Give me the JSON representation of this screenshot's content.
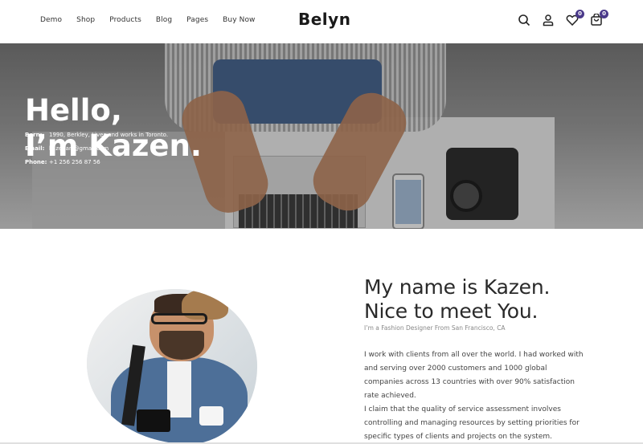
{
  "header": {
    "nav": [
      "Demo",
      "Shop",
      "Products",
      "Blog",
      "Pages",
      "Buy Now"
    ],
    "logo": "Belyn",
    "icons": [
      "search-icon",
      "user-icon",
      "heart-icon",
      "cart-icon"
    ],
    "wishlist_count": "0",
    "cart_count": "0",
    "badge_color": "#4b3a8a"
  },
  "hero": {
    "title_line1": "Hello,",
    "title_line2": "I’m Kazen.",
    "info": [
      {
        "label": "Born:",
        "value": "1990, Berkley, Lives and works in Toronto."
      },
      {
        "label": "Email:",
        "value": "kazenart@gmail.com"
      },
      {
        "label": "Phone:",
        "value": "+1 256 256 87 56"
      }
    ]
  },
  "about": {
    "title_line1": "My name is Kazen.",
    "title_line2": "Nice to meet You.",
    "subtitle": "I’m a Fashion Designer From San Francisco, CA",
    "paragraph1": "I work with clients from all over the world. I had worked with and serving over 2000 customers and 1000 global companies across 13 countries with over 90% satisfaction rate achieved.",
    "paragraph2": "I claim that the quality of service assessment involves controlling and managing resources by setting priorities for specific types of clients and projects on the system."
  }
}
